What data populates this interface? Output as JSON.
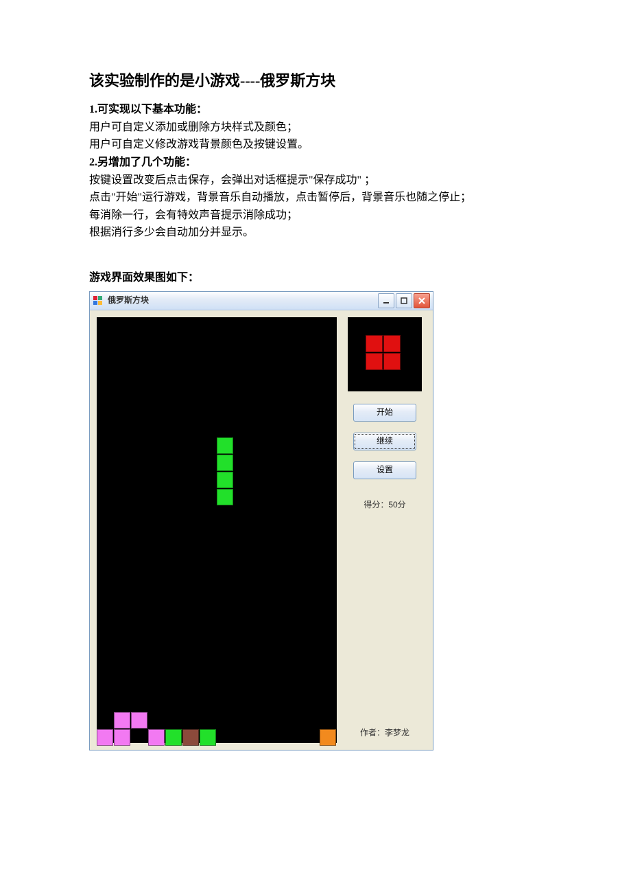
{
  "title": "该实验制作的是小游戏----俄罗斯方块",
  "section1_head": "1.可实现以下基本功能：",
  "section1_lines": [
    "用户可自定义添加或删除方块样式及颜色；",
    "用户可自定义修改游戏背景颜色及按键设置。"
  ],
  "section2_head": "2.另增加了几个功能：",
  "section2_lines": [
    "按键设置改变后点击保存，会弹出对话框提示\"保存成功\"  ；",
    "点击\"开始\"运行游戏，背景音乐自动播放，点击暂停后，背景音乐也随之停止；",
    "每消除一行，会有特效声音提示消除成功；",
    "根据消行多少会自动加分并显示。"
  ],
  "caption": "游戏界面效果图如下：",
  "window": {
    "title": "俄罗斯方块",
    "buttons": {
      "start": "开始",
      "continue": "继续",
      "settings": "设置"
    },
    "score_label": "得分：50分",
    "author_label": "作者：李梦龙",
    "playfield": {
      "cols": 14,
      "rows": 25,
      "cell": 25,
      "cells": [
        {
          "c": 7,
          "r": 7,
          "color": "#22E02A"
        },
        {
          "c": 7,
          "r": 8,
          "color": "#22E02A"
        },
        {
          "c": 7,
          "r": 9,
          "color": "#22E02A"
        },
        {
          "c": 7,
          "r": 10,
          "color": "#22E02A"
        },
        {
          "c": 1,
          "r": 23,
          "color": "#F279F2"
        },
        {
          "c": 2,
          "r": 23,
          "color": "#F279F2"
        },
        {
          "c": 0,
          "r": 24,
          "color": "#F279F2"
        },
        {
          "c": 1,
          "r": 24,
          "color": "#F279F2"
        },
        {
          "c": 3,
          "r": 24,
          "color": "#F279F2"
        },
        {
          "c": 4,
          "r": 24,
          "color": "#22E02A"
        },
        {
          "c": 5,
          "r": 24,
          "color": "#8B4A3B"
        },
        {
          "c": 6,
          "r": 24,
          "color": "#22E02A"
        },
        {
          "c": 13,
          "r": 24,
          "color": "#F28A1E"
        }
      ]
    },
    "preview": {
      "cell": 26,
      "cells": [
        {
          "c": 1,
          "r": 1,
          "color": "#E01010"
        },
        {
          "c": 2,
          "r": 1,
          "color": "#E01010"
        },
        {
          "c": 1,
          "r": 2,
          "color": "#E01010"
        },
        {
          "c": 2,
          "r": 2,
          "color": "#E01010"
        }
      ]
    }
  }
}
